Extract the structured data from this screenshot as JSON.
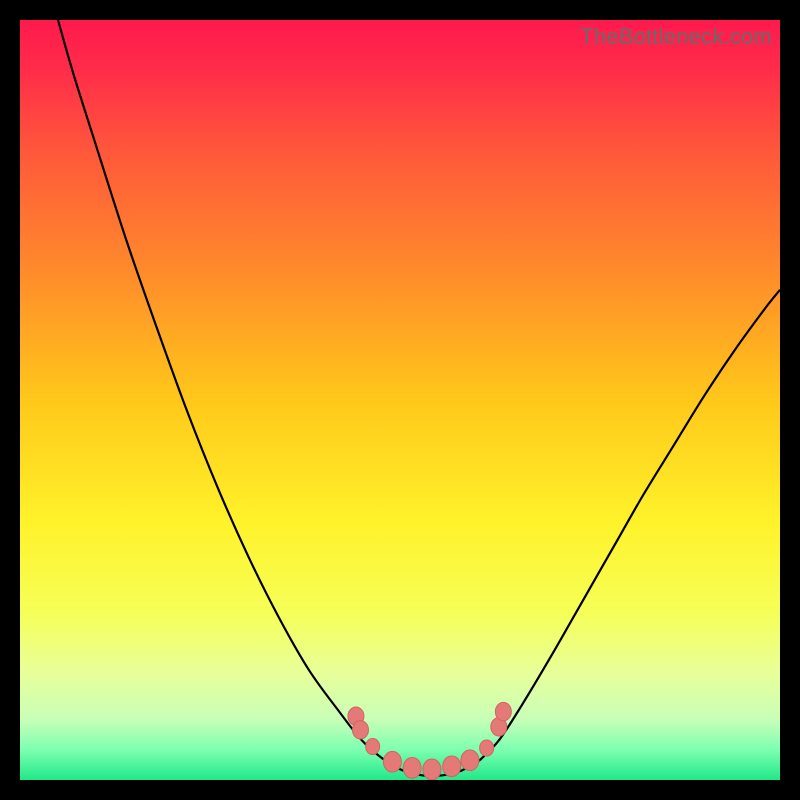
{
  "watermark": "TheBottleneck.com",
  "chart_data": {
    "type": "line",
    "title": "",
    "xlabel": "",
    "ylabel": "",
    "xlim": [
      0,
      100
    ],
    "ylim": [
      0,
      100
    ],
    "gradient_stops": [
      {
        "offset": 0.0,
        "color": "#ff1a4d"
      },
      {
        "offset": 0.06,
        "color": "#ff2a4a"
      },
      {
        "offset": 0.18,
        "color": "#ff5a3a"
      },
      {
        "offset": 0.34,
        "color": "#ff8e2a"
      },
      {
        "offset": 0.5,
        "color": "#ffc81a"
      },
      {
        "offset": 0.66,
        "color": "#fff22a"
      },
      {
        "offset": 0.78,
        "color": "#f6ff58"
      },
      {
        "offset": 0.86,
        "color": "#e8ff9a"
      },
      {
        "offset": 0.92,
        "color": "#c8ffb8"
      },
      {
        "offset": 0.96,
        "color": "#7dffb0"
      },
      {
        "offset": 1.0,
        "color": "#20e88a"
      }
    ],
    "series": [
      {
        "name": "left-curve",
        "points": [
          {
            "x": 5.0,
            "y": 100.0
          },
          {
            "x": 7.0,
            "y": 93.0
          },
          {
            "x": 10.0,
            "y": 83.5
          },
          {
            "x": 14.0,
            "y": 71.0
          },
          {
            "x": 18.0,
            "y": 59.5
          },
          {
            "x": 22.0,
            "y": 48.5
          },
          {
            "x": 26.0,
            "y": 38.5
          },
          {
            "x": 30.0,
            "y": 29.5
          },
          {
            "x": 34.0,
            "y": 21.5
          },
          {
            "x": 38.0,
            "y": 14.5
          },
          {
            "x": 42.0,
            "y": 9.0
          },
          {
            "x": 45.0,
            "y": 5.2
          },
          {
            "x": 48.0,
            "y": 2.6
          },
          {
            "x": 50.5,
            "y": 1.2
          },
          {
            "x": 53.0,
            "y": 0.6
          },
          {
            "x": 55.5,
            "y": 0.6
          },
          {
            "x": 58.0,
            "y": 1.2
          },
          {
            "x": 60.5,
            "y": 2.6
          }
        ]
      },
      {
        "name": "right-curve",
        "points": [
          {
            "x": 60.5,
            "y": 2.6
          },
          {
            "x": 63.0,
            "y": 5.2
          },
          {
            "x": 66.0,
            "y": 9.8
          },
          {
            "x": 70.0,
            "y": 16.5
          },
          {
            "x": 74.0,
            "y": 23.5
          },
          {
            "x": 78.0,
            "y": 30.5
          },
          {
            "x": 82.0,
            "y": 37.5
          },
          {
            "x": 86.0,
            "y": 44.0
          },
          {
            "x": 90.0,
            "y": 50.5
          },
          {
            "x": 94.0,
            "y": 56.5
          },
          {
            "x": 98.0,
            "y": 62.0
          },
          {
            "x": 100.0,
            "y": 64.5
          }
        ]
      }
    ],
    "markers": [
      {
        "x": 44.2,
        "y": 8.4,
        "r": 8
      },
      {
        "x": 44.8,
        "y": 6.6,
        "r": 8
      },
      {
        "x": 46.4,
        "y": 4.4,
        "r": 7
      },
      {
        "x": 49.0,
        "y": 2.4,
        "r": 9
      },
      {
        "x": 51.6,
        "y": 1.6,
        "r": 9
      },
      {
        "x": 54.2,
        "y": 1.4,
        "r": 9
      },
      {
        "x": 56.8,
        "y": 1.8,
        "r": 9
      },
      {
        "x": 59.2,
        "y": 2.6,
        "r": 9
      },
      {
        "x": 61.4,
        "y": 4.2,
        "r": 7
      },
      {
        "x": 63.0,
        "y": 7.0,
        "r": 8
      },
      {
        "x": 63.6,
        "y": 9.0,
        "r": 8
      }
    ]
  }
}
